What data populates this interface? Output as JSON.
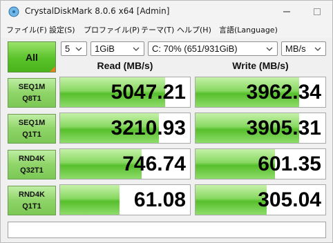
{
  "window": {
    "title": "CrystalDiskMark 8.0.6 x64 [Admin]"
  },
  "menu": [
    "ファイル(F)",
    "設定(S)",
    "プロファイル(P)",
    "テーマ(T)",
    "ヘルプ(H)",
    "言語(Language)"
  ],
  "controls": {
    "all_label": "All",
    "count": "5",
    "size": "1GiB",
    "drive": "C: 70% (651/931GiB)",
    "unit": "MB/s"
  },
  "headers": {
    "read": "Read (MB/s)",
    "write": "Write (MB/s)"
  },
  "rows": [
    {
      "line1": "SEQ1M",
      "line2": "Q8T1",
      "read": "5047.21",
      "write": "3962.34",
      "read_fill": 0.81,
      "write_fill": 0.8
    },
    {
      "line1": "SEQ1M",
      "line2": "Q1T1",
      "read": "3210.93",
      "write": "3905.31",
      "read_fill": 0.76,
      "write_fill": 0.8
    },
    {
      "line1": "RND4K",
      "line2": "Q32T1",
      "read": "746.74",
      "write": "601.35",
      "read_fill": 0.63,
      "write_fill": 0.61
    },
    {
      "line1": "RND4K",
      "line2": "Q1T1",
      "read": "61.08",
      "write": "305.04",
      "read_fill": 0.46,
      "write_fill": 0.55
    }
  ],
  "comment": "",
  "colors": {
    "accent_green": "#5ac22a",
    "corner_orange": "#e67e22"
  }
}
